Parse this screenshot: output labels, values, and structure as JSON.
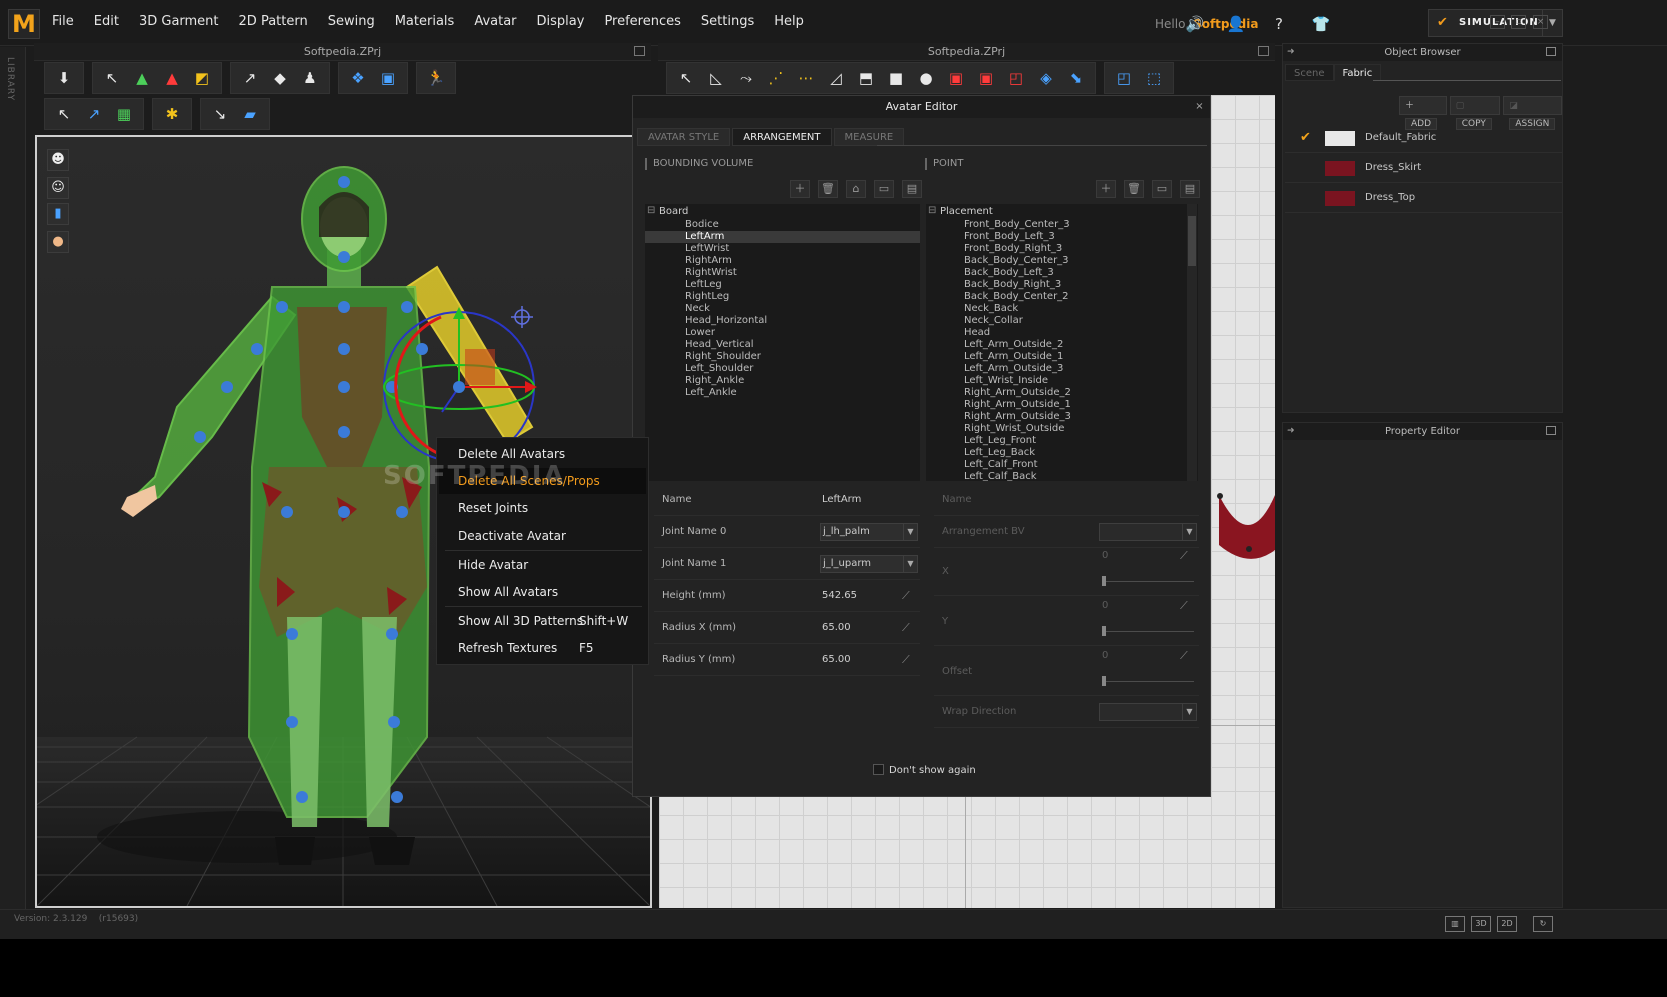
{
  "app": {
    "logo": "M",
    "menus": [
      "File",
      "Edit",
      "3D Garment",
      "2D Pattern",
      "Sewing",
      "Materials",
      "Avatar",
      "Display",
      "Preferences",
      "Settings",
      "Help"
    ],
    "hello_prefix": "Hello,",
    "user": "Softpedia",
    "mode_button": "SIMULATION",
    "accent_color": "#f29b1c"
  },
  "panels": {
    "left_title": "Softpedia.ZPrj",
    "center_title": "Softpedia.ZPrj",
    "library_label": "LIBRARY"
  },
  "context_menu": {
    "items": [
      {
        "label": "Delete All Avatars",
        "shortcut": ""
      },
      {
        "label": "Delete All Scenes/Props",
        "shortcut": ""
      },
      {
        "label": "Reset Joints",
        "shortcut": ""
      },
      {
        "label": "Deactivate Avatar",
        "shortcut": ""
      },
      {
        "label": "Hide Avatar",
        "shortcut": ""
      },
      {
        "label": "Show All Avatars",
        "shortcut": ""
      },
      {
        "label": "Show All 3D Patterns",
        "shortcut": "Shift+W"
      },
      {
        "label": "Refresh Textures",
        "shortcut": "F5"
      }
    ],
    "highlighted_index": 1
  },
  "watermark": "SOFTPEDIA",
  "avatar_editor": {
    "title": "Avatar Editor",
    "tabs": [
      "AVATAR STYLE",
      "ARRANGEMENT",
      "MEASURE"
    ],
    "active_tab": "ARRANGEMENT",
    "bounding_volume": {
      "label": "BOUNDING VOLUME",
      "root": "Board",
      "items": [
        "Bodice",
        "LeftArm",
        "LeftWrist",
        "RightArm",
        "RightWrist",
        "LeftLeg",
        "RightLeg",
        "Neck",
        "Head_Horizontal",
        "Lower",
        "Head_Vertical",
        "Right_Shoulder",
        "Left_Shoulder",
        "Right_Ankle",
        "Left_Ankle"
      ],
      "selected": "LeftArm"
    },
    "point": {
      "label": "POINT",
      "root": "Placement",
      "items": [
        "Front_Body_Center_3",
        "Front_Body_Left_3",
        "Front_Body_Right_3",
        "Back_Body_Center_3",
        "Back_Body_Left_3",
        "Back_Body_Right_3",
        "Back_Body_Center_2",
        "Neck_Back",
        "Neck_Collar",
        "Head",
        "Left_Arm_Outside_2",
        "Left_Arm_Outside_1",
        "Left_Arm_Outside_3",
        "Left_Wrist_Inside",
        "Right_Arm_Outside_2",
        "Right_Arm_Outside_1",
        "Right_Arm_Outside_3",
        "Right_Wrist_Outside",
        "Left_Leg_Front",
        "Left_Leg_Back",
        "Left_Calf_Front",
        "Left_Calf_Back"
      ]
    },
    "bv_properties": {
      "name_label": "Name",
      "name_value": "LeftArm",
      "joint0_label": "Joint Name 0",
      "joint0_value": "j_lh_palm",
      "joint1_label": "Joint Name 1",
      "joint1_value": "j_l_uparm",
      "height_label": "Height (mm)",
      "height_value": "542.65",
      "radiusx_label": "Radius X (mm)",
      "radiusx_value": "65.00",
      "radiusy_label": "Radius Y (mm)",
      "radiusy_value": "65.00"
    },
    "point_properties": {
      "name_label": "Name",
      "arrangement_label": "Arrangement BV",
      "x_label": "X",
      "x_value": "0",
      "y_label": "Y",
      "y_value": "0",
      "offset_label": "Offset",
      "offset_value": "0",
      "wrap_label": "Wrap Direction"
    },
    "dont_show": "Don't show again"
  },
  "object_browser": {
    "title": "Object Browser",
    "tabs": [
      "Scene",
      "Fabric"
    ],
    "active_tab": "Fabric",
    "actions": {
      "add": "ADD",
      "copy": "COPY",
      "assign": "ASSIGN"
    },
    "fabrics": [
      {
        "name": "Default_Fabric",
        "color": "#e8e8e8",
        "checked": true
      },
      {
        "name": "Dress_Skirt",
        "color": "#7a1420",
        "checked": false
      },
      {
        "name": "Dress_Top",
        "color": "#7a1420",
        "checked": false
      }
    ]
  },
  "property_editor": {
    "title": "Property Editor"
  },
  "status": {
    "version": "Version: 2.3.129",
    "revision": "(r15693)",
    "view_modes": [
      "3D",
      "2D"
    ]
  }
}
